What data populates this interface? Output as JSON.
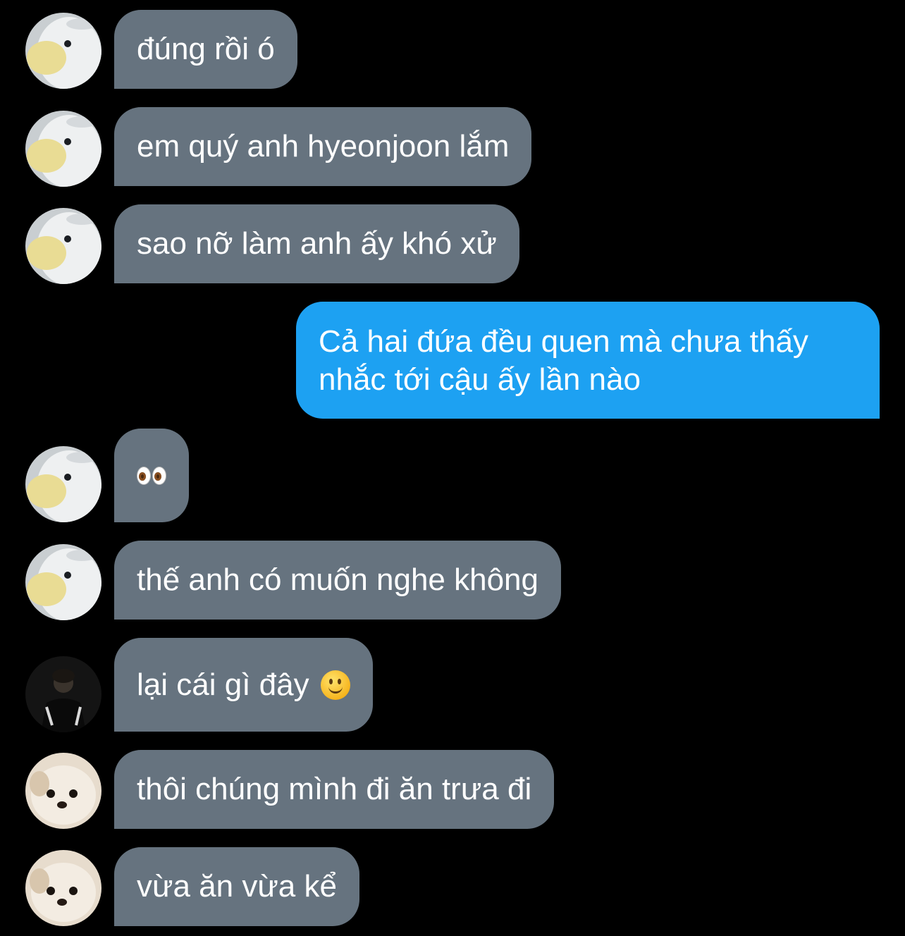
{
  "conversation": {
    "messages": [
      {
        "sender": "received",
        "avatar": "plush-bird-avatar",
        "text": "đúng rồi ó"
      },
      {
        "sender": "received",
        "avatar": "plush-bird-avatar",
        "text": "em quý anh hyeonjoon lắm"
      },
      {
        "sender": "received",
        "avatar": "plush-bird-avatar",
        "text": "sao nỡ làm anh ấy khó xử"
      },
      {
        "sender": "sent",
        "text": "Cả hai đứa đều quen mà chưa thấy nhắc tới cậu ấy lần nào"
      },
      {
        "sender": "received",
        "avatar": "plush-bird-avatar",
        "text": "👀"
      },
      {
        "sender": "received",
        "avatar": "plush-bird-avatar",
        "text": "thế anh có muốn nghe không"
      },
      {
        "sender": "received",
        "avatar": "person-dark-avatar",
        "text": "lại cái gì đây",
        "emoji": "slight-smile-emoji"
      },
      {
        "sender": "received",
        "avatar": "pomeranian-avatar",
        "text": "thôi chúng mình đi ăn trưa đi"
      },
      {
        "sender": "received",
        "avatar": "pomeranian-avatar",
        "text": "vừa ăn vừa kể"
      }
    ]
  },
  "colors": {
    "background": "#000000",
    "received_bubble": "#66737f",
    "sent_bubble": "#1da1f2",
    "text": "#ffffff"
  }
}
